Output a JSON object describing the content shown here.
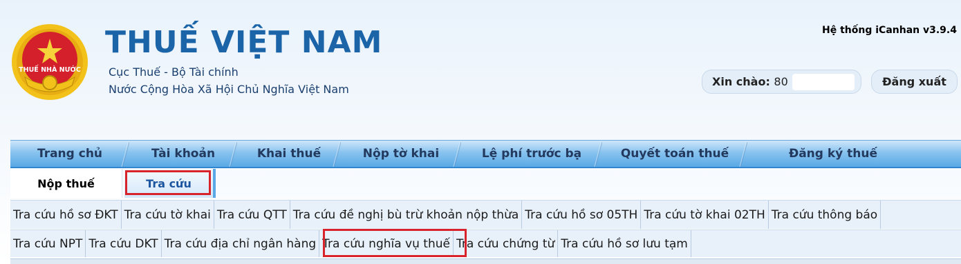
{
  "header": {
    "brand_title": "THUẾ VIỆT NAM",
    "subtitle_line1": "Cục Thuế - Bộ Tài chính",
    "subtitle_line2": "Nước Cộng Hòa Xã Hội Chủ Nghĩa Việt Nam",
    "emblem_text": "THUẾ NHÀ NƯỚC",
    "system_version": "Hệ thống iCanhan v3.9.4",
    "greeting_label": "Xin chào:",
    "greeting_user": "80",
    "logout_label": "Đăng xuất"
  },
  "main_nav": {
    "items": [
      {
        "label": "Trang chủ"
      },
      {
        "label": "Tài khoản"
      },
      {
        "label": "Khai thuế"
      },
      {
        "label": "Nộp tờ khai"
      },
      {
        "label": "Lệ phí trước bạ"
      },
      {
        "label": "Quyết toán thuế"
      },
      {
        "label": "Đăng ký thuế"
      }
    ]
  },
  "sub_tabs": {
    "items": [
      {
        "label": "Nộp thuế"
      },
      {
        "label": "Tra cứu"
      }
    ],
    "active": "Tra cứu"
  },
  "lookup_links": {
    "row1": [
      "Tra cứu hồ sơ ĐKT",
      "Tra cứu tờ khai",
      "Tra cứu QTT",
      "Tra cứu đề nghị bù trừ khoản nộp thừa",
      "Tra cứu hồ sơ 05TH",
      "Tra cứu tờ khai 02TH",
      "Tra cứu thông báo"
    ],
    "row2": [
      "Tra cứu NPT",
      "Tra cứu DKT",
      "Tra cứu địa chỉ ngân hàng",
      "Tra cứu nghĩa vụ thuế",
      "Tra cứu chứng từ",
      "Tra cứu hồ sơ lưu tạm"
    ]
  },
  "colors": {
    "brand_blue": "#1b64a8",
    "nav_blue": "#5aa9e6",
    "highlight_red": "#d9232b",
    "emblem_red": "#d4202a",
    "emblem_gold": "#f2c21b"
  }
}
